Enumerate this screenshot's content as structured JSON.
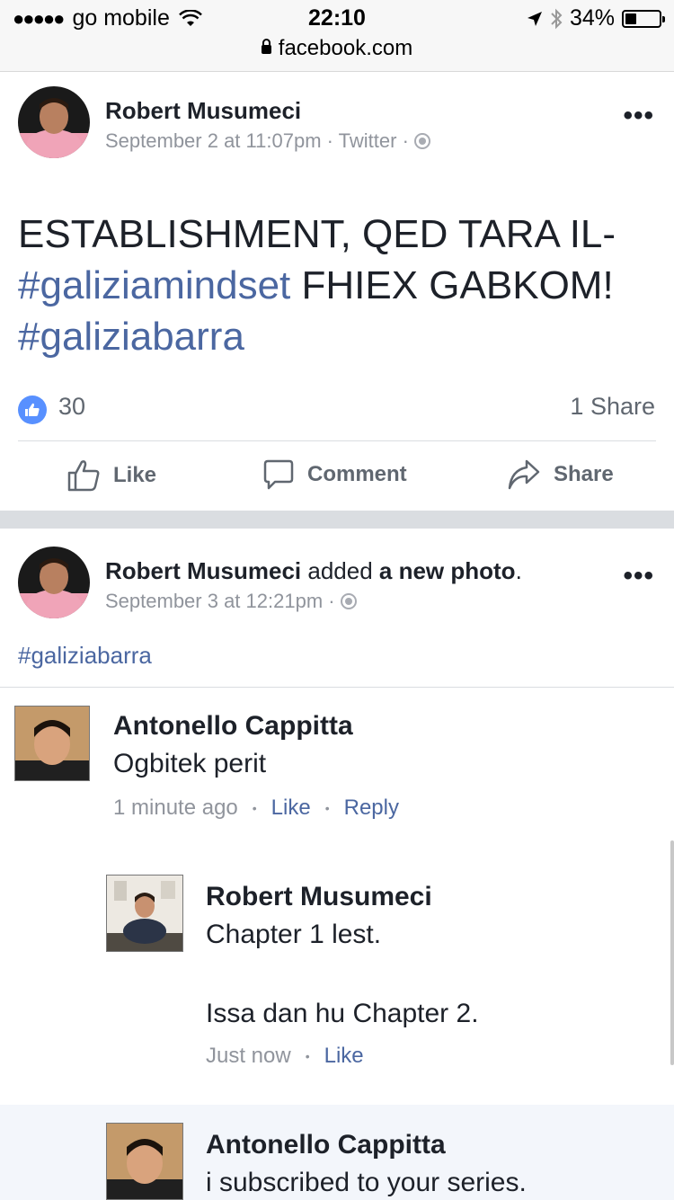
{
  "status": {
    "carrier": "go mobile",
    "signal_dots": "●●●●●",
    "time": "22:10",
    "battery": "34%",
    "battery_level": 0.34,
    "url": "facebook.com"
  },
  "post1": {
    "author": "Robert Musumeci",
    "meta": "September 2 at 11:07pm · Twitter ·",
    "text_line1": "ESTABLISHMENT, QED TARA IL-",
    "hashtag1": "#galiziamindset",
    "text_line2": " FHIEX GABKOM!",
    "hashtag2": "#galiziabarra",
    "likes": "30",
    "shares": "1 Share",
    "more": "•••",
    "actions": {
      "like": "Like",
      "comment": "Comment",
      "share": "Share"
    }
  },
  "post2": {
    "author": "Robert Musumeci",
    "action_text": " added ",
    "action_object": "a new photo",
    "action_end": ".",
    "meta": "September 3 at 12:21pm ·",
    "more": "•••",
    "hashtag": "#galiziabarra"
  },
  "screenshot": {
    "comment1": {
      "author": "Antonello Cappitta",
      "text": "Ogbitek perit",
      "time": "1 minute ago",
      "like": "Like",
      "reply": "Reply"
    },
    "reply1": {
      "author": "Robert Musumeci",
      "text_line1": "Chapter 1 lest.",
      "text_line2": "Issa dan hu Chapter 2.",
      "time": "Just now",
      "like": "Like"
    },
    "comment2": {
      "author": "Antonello Cappitta",
      "text": "i subscribed to your series."
    },
    "separator": "•"
  }
}
